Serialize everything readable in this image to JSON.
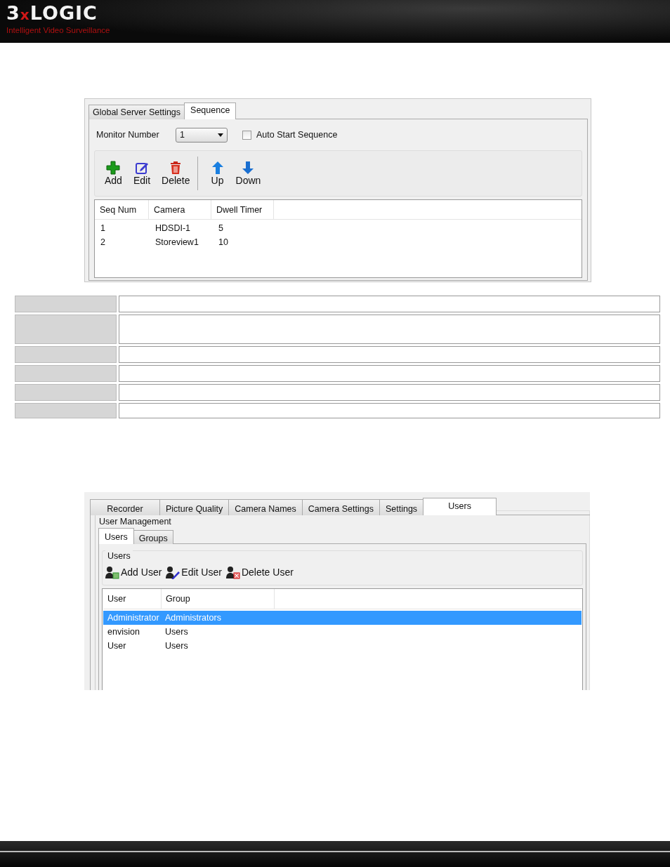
{
  "header": {
    "logo_prefix": "3",
    "logo_x": "x",
    "logo_suffix": "LOGIC",
    "tagline": "Intelligent Video Surveillance"
  },
  "sequence_window": {
    "tabs": [
      {
        "label": "Global Server Settings",
        "selected": false
      },
      {
        "label": "Sequence",
        "selected": true
      }
    ],
    "monitor_label": "Monitor Number",
    "monitor_value": "1",
    "auto_start": {
      "label": "Auto Start Sequence",
      "checked": false
    },
    "toolbar": [
      {
        "label": "Add",
        "kind": "add"
      },
      {
        "label": "Edit",
        "kind": "edit"
      },
      {
        "label": "Delete",
        "kind": "delete"
      },
      {
        "kind": "separator"
      },
      {
        "label": "Up",
        "kind": "up"
      },
      {
        "label": "Down",
        "kind": "down"
      }
    ],
    "table": {
      "columns": [
        "Seq Num",
        "Camera",
        "Dwell Timer"
      ],
      "rows": [
        [
          "1",
          "HDSDI-1",
          "5"
        ],
        [
          "2",
          "Storeview1",
          "10"
        ]
      ]
    }
  },
  "info_table": {
    "rows": [
      {
        "kind": "normal"
      },
      {
        "kind": "tall"
      },
      {
        "kind": "normal"
      },
      {
        "kind": "normal"
      },
      {
        "kind": "normal"
      },
      {
        "kind": "short"
      }
    ]
  },
  "users_window": {
    "tabs": [
      {
        "label": "Recorder",
        "selected": false
      },
      {
        "label": "Picture Quality",
        "selected": false
      },
      {
        "label": "Camera Names",
        "selected": false
      },
      {
        "label": "Camera Settings",
        "selected": false
      },
      {
        "label": "Settings",
        "selected": false
      },
      {
        "label": "Users",
        "selected": true
      }
    ],
    "group_title": "User Management",
    "subtabs": [
      {
        "label": "Users",
        "selected": true
      },
      {
        "label": "Groups",
        "selected": false
      }
    ],
    "users_group_title": "Users",
    "toolbar": [
      {
        "label": "Add User",
        "kind": "add"
      },
      {
        "label": "Edit User",
        "kind": "edit"
      },
      {
        "label": "Delete User",
        "kind": "delete"
      }
    ],
    "table": {
      "columns": [
        "User",
        "Group"
      ],
      "rows": [
        {
          "cells": [
            "Administrator",
            "Administrators"
          ],
          "selected": true
        },
        {
          "cells": [
            "envision",
            "Users"
          ],
          "selected": false
        },
        {
          "cells": [
            "User",
            "Users"
          ],
          "selected": false
        }
      ]
    }
  }
}
